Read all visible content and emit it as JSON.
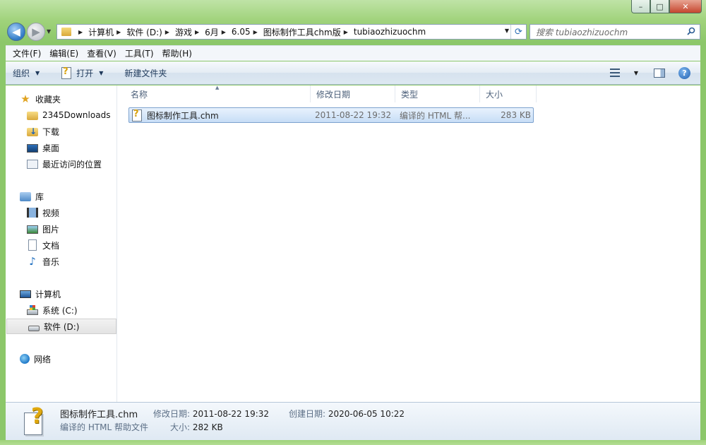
{
  "window": {
    "caption_buttons": {
      "minimize": "–",
      "maximize": "□",
      "close": "✕"
    }
  },
  "breadcrumb": [
    "计算机",
    "软件 (D:)",
    "游戏",
    "6月",
    "6.05",
    "图标制作工具chm版",
    "tubiaozhizuochm"
  ],
  "search": {
    "placeholder": "搜索 tubiaozhizuochm"
  },
  "menubar": [
    "文件(F)",
    "编辑(E)",
    "查看(V)",
    "工具(T)",
    "帮助(H)"
  ],
  "commandbar": {
    "organize": "组织",
    "open": "打开",
    "new_folder": "新建文件夹"
  },
  "navpane": {
    "favorites": {
      "label": "收藏夹",
      "items": [
        "2345Downloads",
        "下载",
        "桌面",
        "最近访问的位置"
      ]
    },
    "libraries": {
      "label": "库",
      "items": [
        "视频",
        "图片",
        "文档",
        "音乐"
      ]
    },
    "computer": {
      "label": "计算机",
      "items": [
        "系统 (C:)",
        "软件 (D:)"
      ]
    },
    "network": {
      "label": "网络"
    }
  },
  "columns": [
    "名称",
    "修改日期",
    "类型",
    "大小"
  ],
  "files": [
    {
      "name": "图标制作工具.chm",
      "modified": "2011-08-22 19:32",
      "type": "编译的 HTML 帮...",
      "size": "283 KB"
    }
  ],
  "details": {
    "name": "图标制作工具.chm",
    "type": "编译的 HTML 帮助文件",
    "modified_label": "修改日期:",
    "modified": "2011-08-22 19:32",
    "created_label": "创建日期:",
    "created": "2020-06-05 10:22",
    "size_label": "大小:",
    "size": "282 KB"
  }
}
